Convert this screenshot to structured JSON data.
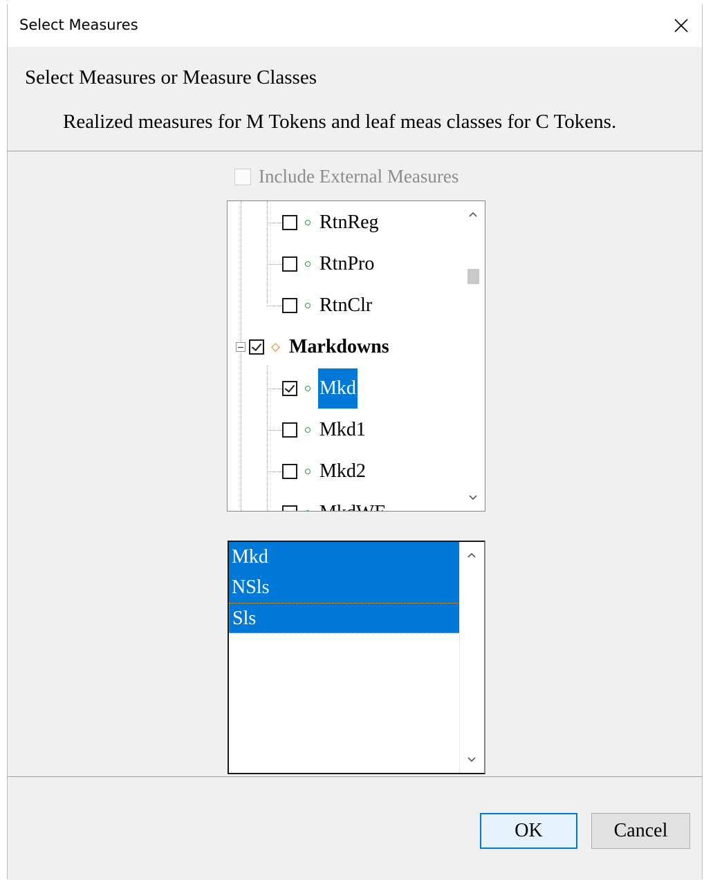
{
  "window": {
    "title": "Select Measures",
    "close_icon": "close-icon"
  },
  "header": {
    "heading": "Select Measures or Measure Classes",
    "subheading": "Realized measures for M Tokens and leaf meas classes for C Tokens."
  },
  "external_checkbox": {
    "label": "Include External Measures",
    "checked": false,
    "enabled": false
  },
  "tree": {
    "nodes": [
      {
        "label": "RtnReg",
        "level": 2,
        "checked": false,
        "icon": "measure-circle-icon"
      },
      {
        "label": "RtnPro",
        "level": 2,
        "checked": false,
        "icon": "measure-circle-icon"
      },
      {
        "label": "RtnClr",
        "level": 2,
        "checked": false,
        "icon": "measure-circle-icon"
      },
      {
        "label": "Markdowns",
        "level": 1,
        "checked": true,
        "icon": "class-diamond-icon",
        "expanded": true
      },
      {
        "label": "Mkd",
        "level": 2,
        "checked": true,
        "icon": "measure-circle-icon",
        "selected": true
      },
      {
        "label": "Mkd1",
        "level": 2,
        "checked": false,
        "icon": "measure-circle-icon"
      },
      {
        "label": "Mkd2",
        "level": 2,
        "checked": false,
        "icon": "measure-circle-icon"
      },
      {
        "label": "MkdWE",
        "level": 2,
        "checked": false,
        "icon": "measure-circle-icon"
      }
    ],
    "scroll_up_icon": "chevron-up-icon",
    "scroll_down_icon": "chevron-down-icon"
  },
  "selected_list": {
    "items": [
      "Mkd",
      "NSls",
      "Sls"
    ],
    "scroll_up_icon": "chevron-up-icon",
    "scroll_down_icon": "chevron-down-icon"
  },
  "buttons": {
    "ok": "OK",
    "cancel": "Cancel"
  },
  "colors": {
    "selection": "#0078d7",
    "dialog_bg": "#f0f0f0"
  }
}
